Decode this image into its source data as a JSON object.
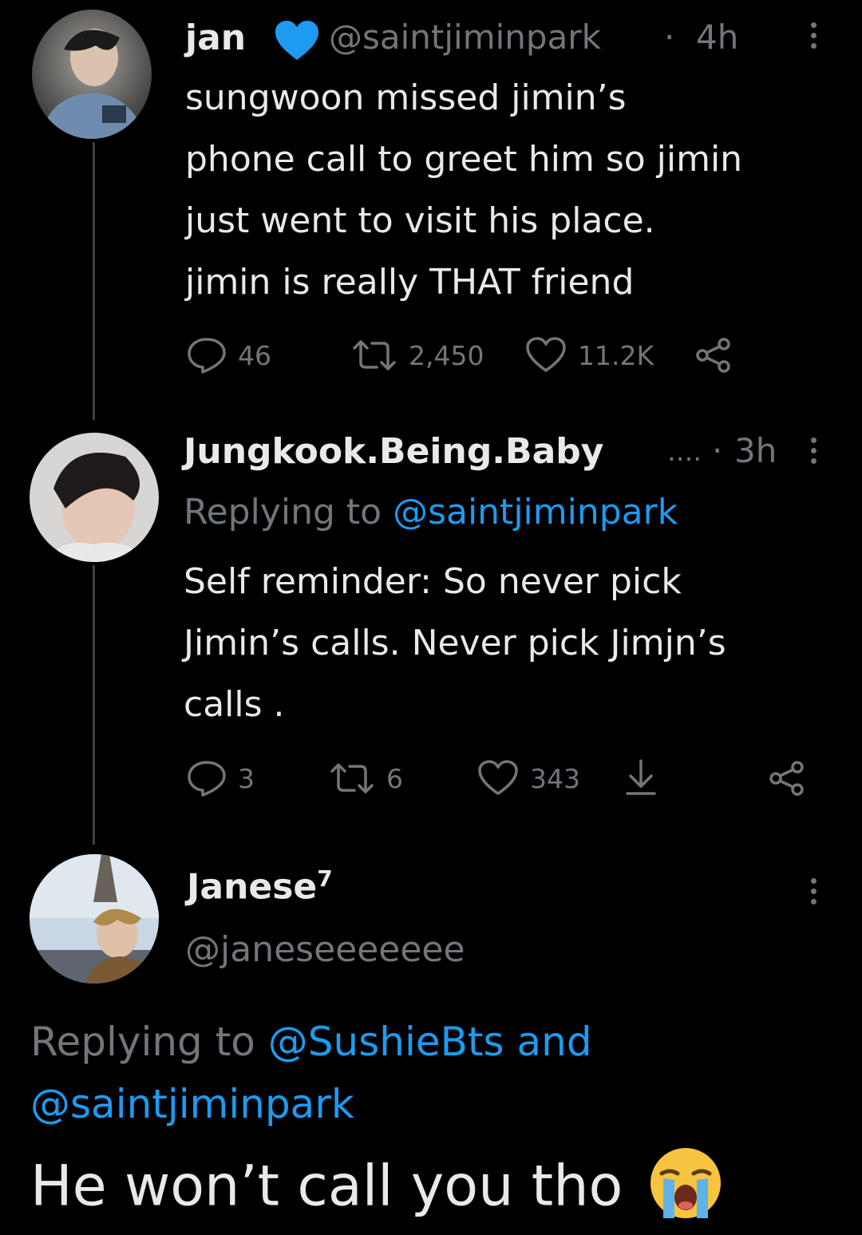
{
  "tweets": [
    {
      "name": "jan",
      "handle": "@saintjiminpark",
      "sep": "·",
      "time": "4h",
      "text_lines": [
        "sungwoon missed jimin’s",
        "phone call to greet him so jimin",
        "just went to visit his place.",
        "jimin is really THAT friend"
      ],
      "replies": "46",
      "retweets": "2,450",
      "likes": "11.2K"
    },
    {
      "name": "Jungkook.Being.Baby",
      "ellipsis": "....",
      "sep": "·",
      "time": "3h",
      "replying_prefix": "Replying to",
      "replying_handle": "@saintjiminpark",
      "text_lines": [
        "Self reminder: So never pick",
        "Jimin’s calls. Never pick Jimjn’s",
        "calls ."
      ],
      "replies": "3",
      "retweets": "6",
      "likes": "343"
    }
  ],
  "focused_tweet": {
    "name": "Janese",
    "name_sup": "7",
    "handle": "@janeseeeeeee",
    "replying_prefix": "Replying to",
    "replying_handle_1": "@SushieBts",
    "replying_and": "and",
    "replying_handle_2": "@saintjiminpark",
    "text": "He won’t call you tho",
    "emoji": "😭"
  },
  "icons": {
    "verified": "verified-heart-icon",
    "reply": "reply-icon",
    "retweet": "retweet-icon",
    "like": "heart-icon",
    "share": "share-icon",
    "download": "download-icon",
    "more": "more-vertical-icon"
  },
  "colors": {
    "background": "#000000",
    "text": "#e7e9ea",
    "muted": "#71767b",
    "accent": "#1d9bf0"
  }
}
